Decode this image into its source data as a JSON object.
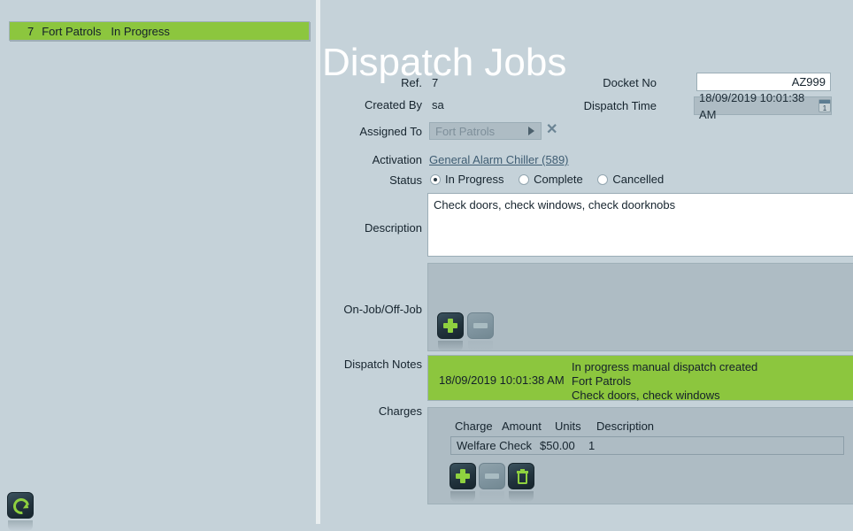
{
  "window": {
    "title": "Dispatch Jobs"
  },
  "job_list": {
    "items": [
      {
        "ref": "7",
        "name": "Fort Patrols",
        "status": "In Progress"
      }
    ]
  },
  "form": {
    "labels": {
      "ref": "Ref.",
      "created_by": "Created By",
      "assigned_to": "Assigned To",
      "activation": "Activation",
      "status": "Status",
      "description": "Description",
      "on_off_job": "On-Job/Off-Job",
      "dispatch_notes": "Dispatch Notes",
      "charges": "Charges",
      "docket_no": "Docket No",
      "dispatch_time": "Dispatch Time"
    },
    "ref_value": "7",
    "created_by_value": "sa",
    "assigned_to_value": "Fort Patrols",
    "activation_link": "General Alarm Chiller (589)",
    "status_options": [
      {
        "label": "In Progress",
        "selected": true
      },
      {
        "label": "Complete",
        "selected": false
      },
      {
        "label": "Cancelled",
        "selected": false
      }
    ],
    "description_value": "Check doors, check windows, check doorknobs",
    "docket_no_value": "AZ999",
    "dispatch_time_value": "18/09/2019 10:01:38 AM",
    "calendar_day": "1"
  },
  "on_off_job": {
    "buttons": {
      "add": "add-row-button",
      "remove": "remove-row-button",
      "save": "save-button",
      "cancel": "cancel-button"
    }
  },
  "dispatch_notes": {
    "entries": [
      {
        "time": "18/09/2019 10:01:38 AM",
        "line1": "In progress manual dispatch created",
        "line2": "Fort Patrols",
        "line3": "Check doors, check windows"
      }
    ]
  },
  "charges": {
    "columns": [
      "Charge",
      "Amount",
      "Units",
      "Description"
    ],
    "rows": [
      {
        "charge": "Welfare Check",
        "amount": "$50.00",
        "units": "1",
        "description": ""
      }
    ],
    "buttons": {
      "add": "add-charge-button",
      "remove": "remove-charge-button",
      "delete": "delete-charge-button"
    }
  },
  "status_bar": {
    "refresh": "refresh-button"
  },
  "colors": {
    "background": "#c5d2d9",
    "accent_green": "#8cc63e",
    "panel": "#aebcc4",
    "glyph_green": "#8fd13f",
    "link": "#3f5d73"
  }
}
